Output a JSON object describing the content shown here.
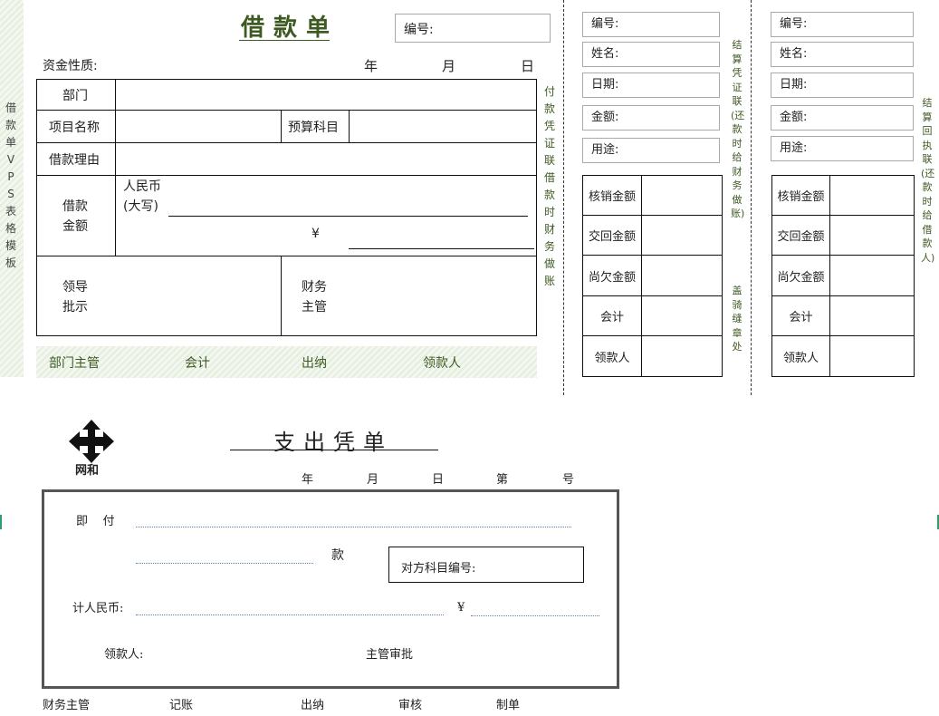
{
  "side_label": "借款单VPS表格模板",
  "loan_form": {
    "title": "借款单",
    "number_label": "编号:",
    "fund_nature_label": "资金性质:",
    "date_year": "年",
    "date_month": "月",
    "date_day": "日",
    "dept_label": "部门",
    "project_label": "项目名称",
    "budget_label": "预算科目",
    "reason_label": "借款理由",
    "amount_label_1": "借款",
    "amount_label_2": "金额",
    "rmb_label": "人民币",
    "rmb_caps_label": "(大写)",
    "yen_symbol": "¥",
    "leader_label_1": "领导",
    "leader_label_2": "批示",
    "finance_label_1": "财务",
    "finance_label_2": "主管",
    "footer": [
      "部门主管",
      "会计",
      "出纳",
      "领款人"
    ],
    "right_side_label": "付款凭证联借款时财务做账"
  },
  "voucher_stub": {
    "fields": [
      "编号:",
      "姓名:",
      "日期:",
      "金额:",
      "用途:"
    ],
    "rows": [
      "核销金额",
      "交回金额",
      "尚欠金额",
      "会计",
      "领款人"
    ],
    "side_label_top": "结算凭证联(还款时给财务做账)",
    "side_label_bottom": "盖骑缝章处"
  },
  "receipt_stub": {
    "fields": [
      "编号:",
      "姓名:",
      "日期:",
      "金额:",
      "用途:"
    ],
    "rows": [
      "核销金额",
      "交回金额",
      "尚欠金额",
      "会计",
      "领款人"
    ],
    "side_label": "结算回执联(还款时给借款人)"
  },
  "expense_form": {
    "logo_text": "网和",
    "title": "支出凭单",
    "date_year": "年",
    "date_month": "月",
    "date_day": "日",
    "date_no": "第",
    "date_hao": "号",
    "pay_label": "即    付",
    "kuan_label": "款",
    "account_label": "对方科目编号:",
    "rmb_label": "计人民币:",
    "yen_symbol": "¥",
    "receiver_label": "领款人:",
    "approval_label": "主管审批",
    "footer": [
      "财务主管",
      "记账",
      "出纳",
      "审核",
      "制单"
    ]
  },
  "colors": {
    "title_green": "#3d5a22",
    "hatch": "#e4eede",
    "dotted_blue": "#5a7fb0"
  }
}
